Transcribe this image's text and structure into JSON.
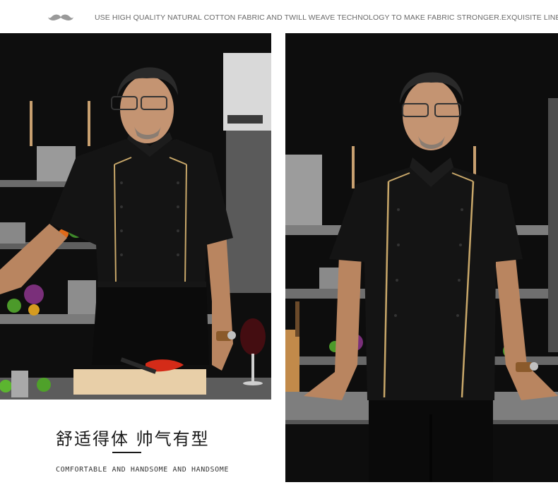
{
  "header": {
    "tagline": "USE HIGH QUALITY NATURAL COTTON FABRIC AND TWILL WEAVE TECHNOLOGY TO MAKE FABRIC STRONGER.EXQUISITE LINE.",
    "logo_icon": "mustache-icon"
  },
  "photos": {
    "left": {
      "subject": "chef-in-black-jacket-with-apron-kitchen-scene"
    },
    "right": {
      "subject": "chef-in-black-jacket-front-view-kitchen-scene"
    }
  },
  "caption": {
    "chinese": "舒适得体 帅气有型",
    "english": "COMFORTABLE AND HANDSOME AND HANDSOME"
  },
  "colors": {
    "jacket": "#141414",
    "piping": "#c9a86a",
    "background": "#ffffff",
    "text_dark": "#1a1a1a"
  }
}
